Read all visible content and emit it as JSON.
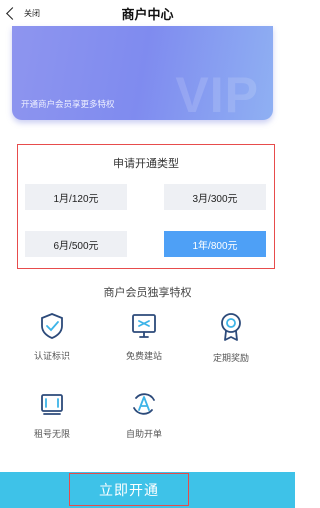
{
  "header": {
    "back_label": "关闭",
    "title": "商户中心"
  },
  "vip_card": {
    "watermark": "VIP",
    "note": "开通商户会员享更多特权"
  },
  "plans": {
    "title": "申请开通类型",
    "options": [
      {
        "label": "1月/120元",
        "selected": false
      },
      {
        "label": "3月/300元",
        "selected": false
      },
      {
        "label": "6月/500元",
        "selected": false
      },
      {
        "label": "1年/800元",
        "selected": true
      }
    ]
  },
  "privileges": {
    "title": "商户会员独享特权",
    "items": [
      {
        "label": "认证标识",
        "icon": "shield-check-icon"
      },
      {
        "label": "免费建站",
        "icon": "monitor-icon"
      },
      {
        "label": "定期奖励",
        "icon": "medal-icon"
      },
      {
        "label": "租号无限",
        "icon": "screen-bracket-icon"
      },
      {
        "label": "自助开单",
        "icon": "letter-a-cycle-icon"
      }
    ]
  },
  "bottom": {
    "open_label": "立即开通"
  },
  "colors": {
    "accent": "#4ea0f6",
    "bottom_bar": "#3ec2e8",
    "highlight_border": "#e74c4c",
    "vip_card": "#8790ef"
  }
}
